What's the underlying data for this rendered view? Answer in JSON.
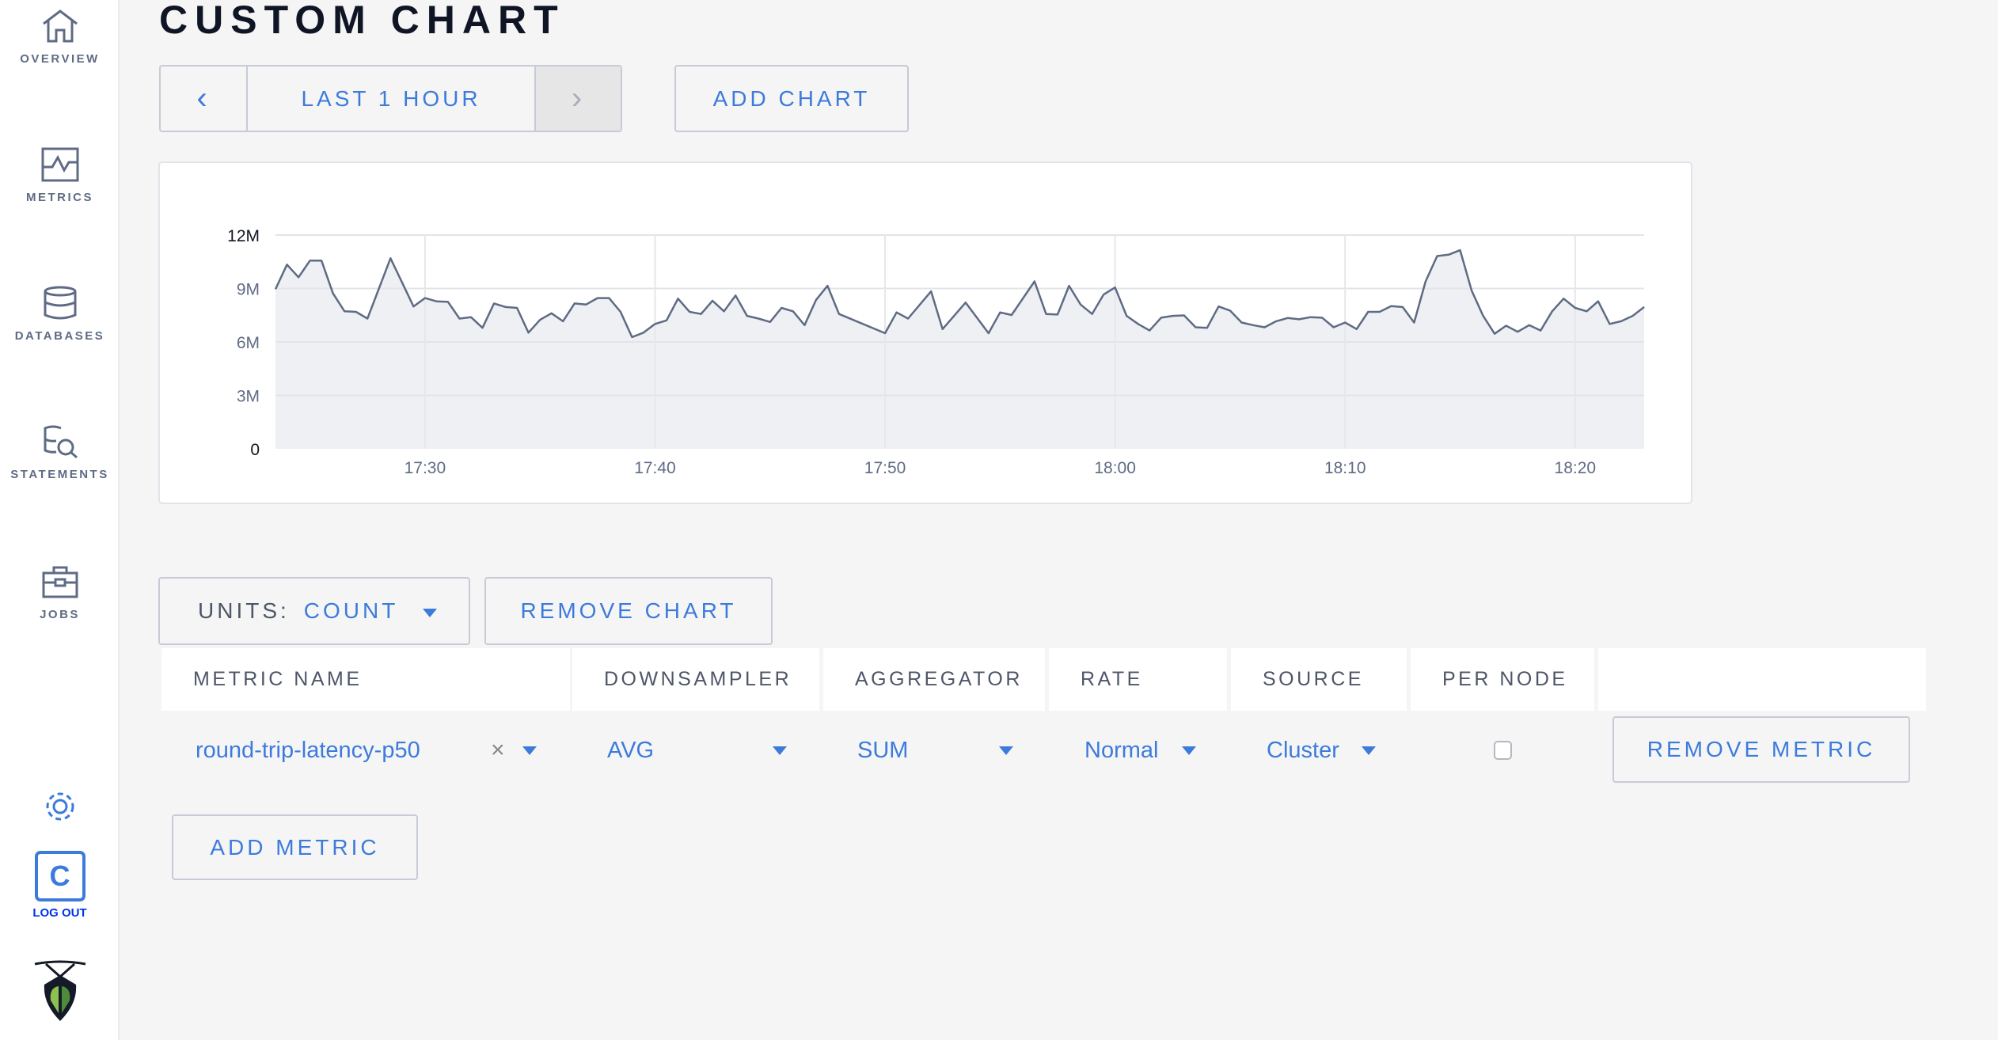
{
  "sidebar": {
    "items": [
      {
        "label": "OVERVIEW",
        "icon": "home-icon"
      },
      {
        "label": "METRICS",
        "icon": "metrics-icon"
      },
      {
        "label": "DATABASES",
        "icon": "database-icon"
      },
      {
        "label": "STATEMENTS",
        "icon": "statements-icon"
      },
      {
        "label": "JOBS",
        "icon": "briefcase-icon"
      }
    ],
    "logout_label": "LOG OUT",
    "user_initial": "C"
  },
  "page": {
    "title": "CUSTOM CHART"
  },
  "toolbar": {
    "prev": "‹",
    "range": "LAST 1 HOUR",
    "next": "›",
    "add_chart": "ADD CHART"
  },
  "chart_controls": {
    "units_label": "UNITS:",
    "units_value": "COUNT",
    "remove_chart": "REMOVE CHART"
  },
  "table": {
    "headers": [
      "METRIC NAME",
      "DOWNSAMPLER",
      "AGGREGATOR",
      "RATE",
      "SOURCE",
      "PER NODE"
    ],
    "rows": [
      {
        "metric": "round-trip-latency-p50",
        "clear": "×",
        "downsampler": "AVG",
        "aggregator": "SUM",
        "rate": "Normal",
        "source": "Cluster",
        "per_node": false,
        "remove": "REMOVE METRIC"
      }
    ],
    "add_metric": "ADD METRIC"
  },
  "colors": {
    "accent": "#3d7bdb",
    "line": "#5f6b84",
    "fill": "#eef0f4"
  },
  "chart_data": {
    "type": "area",
    "ylim": [
      0,
      12
    ],
    "y_ticks": [
      0,
      3,
      6,
      9,
      12
    ],
    "y_tick_labels": [
      "0",
      "3M",
      "6M",
      "9M",
      "12M"
    ],
    "x_range": [
      "17:23:30",
      "18:23:00"
    ],
    "x_ticks": [
      "17:30",
      "17:40",
      "17:50",
      "18:00",
      "18:10",
      "18:20"
    ],
    "grid": true,
    "x": [
      "17:23:30",
      "17:24:00",
      "17:24:30",
      "17:25:00",
      "17:25:30",
      "17:26:00",
      "17:26:30",
      "17:27:00",
      "17:27:30",
      "17:28:30",
      "17:29:30",
      "17:30:00",
      "17:30:30",
      "17:31:00",
      "17:31:30",
      "17:32:00",
      "17:32:30",
      "17:33:00",
      "17:33:30",
      "17:34:00",
      "17:34:30",
      "17:35:00",
      "17:35:30",
      "17:36:00",
      "17:36:30",
      "17:37:00",
      "17:37:30",
      "17:38:00",
      "17:38:30",
      "17:39:00",
      "17:39:30",
      "17:40:00",
      "17:40:30",
      "17:41:00",
      "17:41:30",
      "17:42:00",
      "17:42:30",
      "17:43:00",
      "17:43:30",
      "17:44:00",
      "17:44:30",
      "17:45:00",
      "17:45:30",
      "17:46:00",
      "17:46:30",
      "17:47:00",
      "17:47:30",
      "17:48:00",
      "17:50:00",
      "17:50:30",
      "17:51:00",
      "17:52:00",
      "17:52:30",
      "17:53:30",
      "17:54:30",
      "17:55:00",
      "17:55:30",
      "17:56:30",
      "17:57:00",
      "17:57:30",
      "17:58:00",
      "17:58:30",
      "17:59:00",
      "17:59:30",
      "18:00:00",
      "18:00:30",
      "18:01:00",
      "18:01:30",
      "18:02:00",
      "18:02:30",
      "18:03:00",
      "18:03:30",
      "18:04:00",
      "18:04:30",
      "18:05:00",
      "18:05:30",
      "18:06:00",
      "18:06:30",
      "18:07:00",
      "18:07:30",
      "18:08:00",
      "18:08:30",
      "18:09:00",
      "18:09:30",
      "18:10:00",
      "18:10:30",
      "18:11:00",
      "18:11:30",
      "18:12:00",
      "18:12:30",
      "18:13:00",
      "18:13:30",
      "18:14:00",
      "18:14:30",
      "18:15:00",
      "18:15:30",
      "18:16:00",
      "18:16:30",
      "18:17:00",
      "18:17:30",
      "18:18:00",
      "18:18:30",
      "18:19:00",
      "18:19:30",
      "18:20:00",
      "18:20:30",
      "18:21:00",
      "18:21:30",
      "18:22:00",
      "18:22:30",
      "18:23:00"
    ],
    "y": [
      8.96,
      10.34,
      9.63,
      10.57,
      10.57,
      8.73,
      7.72,
      7.69,
      7.31,
      10.7,
      7.99,
      8.46,
      8.28,
      8.25,
      7.31,
      7.39,
      6.79,
      8.16,
      7.96,
      7.91,
      6.52,
      7.24,
      7.61,
      7.16,
      8.16,
      8.1,
      8.46,
      8.46,
      7.69,
      6.27,
      6.52,
      7.01,
      7.21,
      8.43,
      7.69,
      7.57,
      8.31,
      7.72,
      8.61,
      7.46,
      7.31,
      7.12,
      7.91,
      7.72,
      6.94,
      8.36,
      9.15,
      7.57,
      6.49,
      7.66,
      7.31,
      8.84,
      6.72,
      8.21,
      6.49,
      7.66,
      7.51,
      9.4,
      7.57,
      7.54,
      9.15,
      8.1,
      7.57,
      8.66,
      9.06,
      7.46,
      7.01,
      6.64,
      7.36,
      7.46,
      7.49,
      6.82,
      6.79,
      7.99,
      7.76,
      7.09,
      6.94,
      6.82,
      7.16,
      7.34,
      7.27,
      7.39,
      7.36,
      6.82,
      7.09,
      6.72,
      7.69,
      7.69,
      8.01,
      7.96,
      7.09,
      9.4,
      10.82,
      10.9,
      11.15,
      8.88,
      7.46,
      6.46,
      6.91,
      6.57,
      6.94,
      6.64,
      7.72,
      8.43,
      7.91,
      7.72,
      8.28,
      7.01,
      7.16,
      7.46,
      7.96
    ]
  }
}
